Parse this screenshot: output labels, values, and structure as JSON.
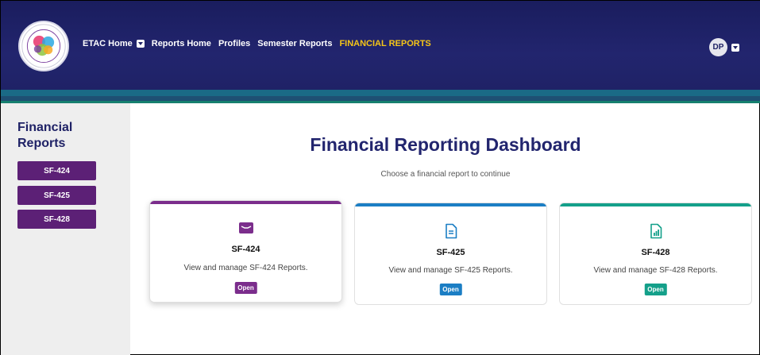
{
  "nav": {
    "items": [
      {
        "label": "ETAC Home",
        "dropdown": true,
        "active": false
      },
      {
        "label": "Reports Home",
        "dropdown": false,
        "active": false
      },
      {
        "label": "Profiles",
        "dropdown": false,
        "active": false
      },
      {
        "label": "Semester Reports",
        "dropdown": false,
        "active": false
      },
      {
        "label": "FINANCIAL REPORTS",
        "dropdown": false,
        "active": true
      }
    ],
    "user_initials": "DP"
  },
  "sidebar": {
    "title": "Financial Reports",
    "buttons": [
      "SF-424",
      "SF-425",
      "SF-428"
    ]
  },
  "main": {
    "title": "Financial Reporting Dashboard",
    "subtitle": "Choose a financial report to continue",
    "cards": [
      {
        "title": "SF-424",
        "description": "View and manage SF-424 Reports.",
        "button": "Open",
        "color": "#7b2d8c",
        "icon": "folder-icon"
      },
      {
        "title": "SF-425",
        "description": "View and manage SF-425 Reports.",
        "button": "Open",
        "color": "#1b7ec4",
        "icon": "document-icon"
      },
      {
        "title": "SF-428",
        "description": "View and manage SF-428 Reports.",
        "button": "Open",
        "color": "#14a08a",
        "icon": "chart-document-icon"
      }
    ]
  },
  "colors": {
    "header": "#1f2266",
    "accent": "#f5c518",
    "sidebar_button": "#5c2076"
  }
}
